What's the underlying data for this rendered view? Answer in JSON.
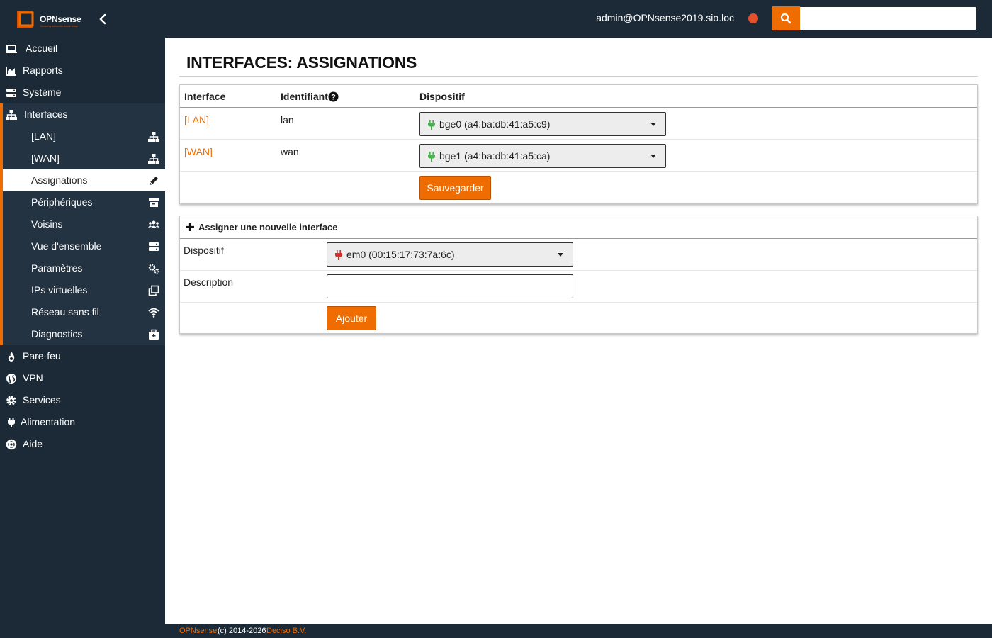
{
  "app": {
    "logo_text": "OPNsense",
    "logo_tagline": "Securing networks made easy",
    "user": "admin@OPNsense2019.sio.loc",
    "search_placeholder": "",
    "accent": "#ef6c00",
    "status_color": "#e4502b"
  },
  "sidebar": {
    "top_items": [
      {
        "label": "Accueil",
        "icon": "laptop-icon"
      },
      {
        "label": "Rapports",
        "icon": "area-chart-icon"
      },
      {
        "label": "Système",
        "icon": "server-icon"
      }
    ],
    "interfaces": {
      "label": "Interfaces",
      "icon": "sitemap-icon",
      "items": [
        {
          "label": "[LAN]",
          "icon": "sitemap-icon"
        },
        {
          "label": "[WAN]",
          "icon": "sitemap-icon"
        },
        {
          "label": "Assignations",
          "icon": "pencil-icon"
        },
        {
          "label": "Périphériques",
          "icon": "archive-icon"
        },
        {
          "label": "Voisins",
          "icon": "users-icon"
        },
        {
          "label": "Vue d'ensemble",
          "icon": "server-icon"
        },
        {
          "label": "Paramètres",
          "icon": "cogs-icon"
        },
        {
          "label": "IPs virtuelles",
          "icon": "clone-icon"
        },
        {
          "label": "Réseau sans fil",
          "icon": "wifi-icon"
        },
        {
          "label": "Diagnostics",
          "icon": "medkit-icon"
        }
      ]
    },
    "bottom_items": [
      {
        "label": "Pare-feu",
        "icon": "fire-icon"
      },
      {
        "label": "VPN",
        "icon": "globe-icon"
      },
      {
        "label": "Services",
        "icon": "cog-icon"
      },
      {
        "label": "Alimentation",
        "icon": "plug-icon"
      },
      {
        "label": "Aide",
        "icon": "life-ring-icon"
      }
    ]
  },
  "page": {
    "title": "INTERFACES: ASSIGNATIONS"
  },
  "assignments": {
    "headers": {
      "interface": "Interface",
      "identifier": "Identifiant",
      "device": "Dispositif"
    },
    "rows": [
      {
        "interface": "[LAN]",
        "identifier": "lan",
        "device": "bge0 (a4:ba:db:41:a5:c9)",
        "plug_color": "#4caf50"
      },
      {
        "interface": "[WAN]",
        "identifier": "wan",
        "device": "bge1 (a4:ba:db:41:a5:ca)",
        "plug_color": "#4caf50"
      }
    ],
    "save_label": "Sauvegarder"
  },
  "new_interface": {
    "title": "Assigner une nouvelle interface",
    "device_label": "Dispositif",
    "device_value": "em0 (00:15:17:73:7a:6c)",
    "plug_color": "#d32f2f",
    "description_label": "Description",
    "description_value": "",
    "add_label": "Ajouter"
  },
  "footer": {
    "brand": "OPNsense",
    "copyright": "(c) 2014-2026",
    "company": "Deciso B.V."
  }
}
